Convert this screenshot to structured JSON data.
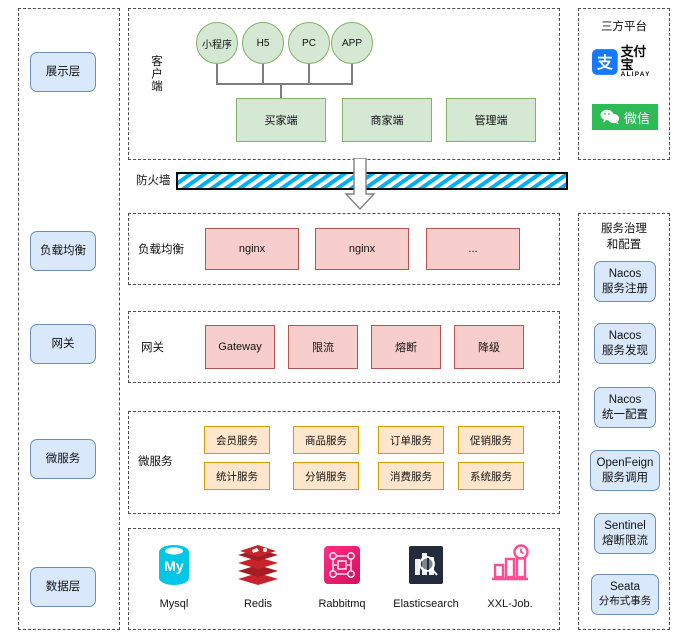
{
  "left_layers": [
    {
      "label": "展示层",
      "name": "layer-presentation"
    },
    {
      "label": "负载均衡",
      "name": "layer-load-balance"
    },
    {
      "label": "网关",
      "name": "layer-gateway"
    },
    {
      "label": "微服务",
      "name": "layer-microservice"
    },
    {
      "label": "数据层",
      "name": "layer-data"
    }
  ],
  "client": {
    "side_label": "客户端",
    "circles": [
      "小程序",
      "H5",
      "PC",
      "APP"
    ],
    "boxes": [
      "买家端",
      "商家端",
      "管理端"
    ]
  },
  "firewall": {
    "label": "防火墙",
    "stripe_color": "#00b0f0"
  },
  "load_balance": {
    "side_label": "负载均衡",
    "boxes": [
      "nginx",
      "nginx",
      "..."
    ]
  },
  "gateway": {
    "side_label": "网关",
    "boxes": [
      "Gateway",
      "限流",
      "熔断",
      "降级"
    ]
  },
  "microservice": {
    "side_label": "微服务",
    "row1": [
      "会员服务",
      "商品服务",
      "订单服务",
      "促销服务"
    ],
    "row2": [
      "统计服务",
      "分销服务",
      "消费服务",
      "系统服务"
    ]
  },
  "data_layer": {
    "items": [
      {
        "label": "Mysql",
        "icon": "mysql-icon",
        "color": "#00c7e6"
      },
      {
        "label": "Redis",
        "icon": "redis-icon",
        "color": "#c6232c"
      },
      {
        "label": "Rabbitmq",
        "icon": "rabbitmq-icon",
        "color": "#ee1c6b"
      },
      {
        "label": "Elasticsearch",
        "icon": "elasticsearch-icon",
        "color": "#222c3c"
      },
      {
        "label": "XXL-Job.",
        "icon": "xxl-job-icon",
        "color": "#ff4d94"
      }
    ]
  },
  "third_party": {
    "title": "三方平台",
    "alipay": {
      "mark": "支",
      "name": "支付宝",
      "sub": "ALIPAY",
      "color": "#1678ff"
    },
    "wechat": {
      "name": "微信",
      "color": "#2dbb55"
    }
  },
  "governance": {
    "title": "服务治理\n和配置",
    "title_line1": "服务治理",
    "title_line2": "和配置",
    "items": [
      {
        "line1": "Nacos",
        "line2": "服务注册"
      },
      {
        "line1": "Nacos",
        "line2": "服务发现"
      },
      {
        "line1": "Nacos",
        "line2": "统一配置"
      },
      {
        "line1": "OpenFeign",
        "line2": "服务调用"
      },
      {
        "line1": "Sentinel",
        "line2": "熔断限流"
      },
      {
        "line1": "Seata",
        "line2": "分布式事务"
      }
    ]
  },
  "colors": {
    "blue_fill": "#dae8fc",
    "blue_stroke": "#6c8ebf",
    "green_fill": "#d5e8d4",
    "green_stroke": "#82b366",
    "pink_fill": "#f8cecc",
    "pink_stroke": "#b85450",
    "orange_fill": "#ffe6cc",
    "orange_stroke": "#d79b00"
  }
}
